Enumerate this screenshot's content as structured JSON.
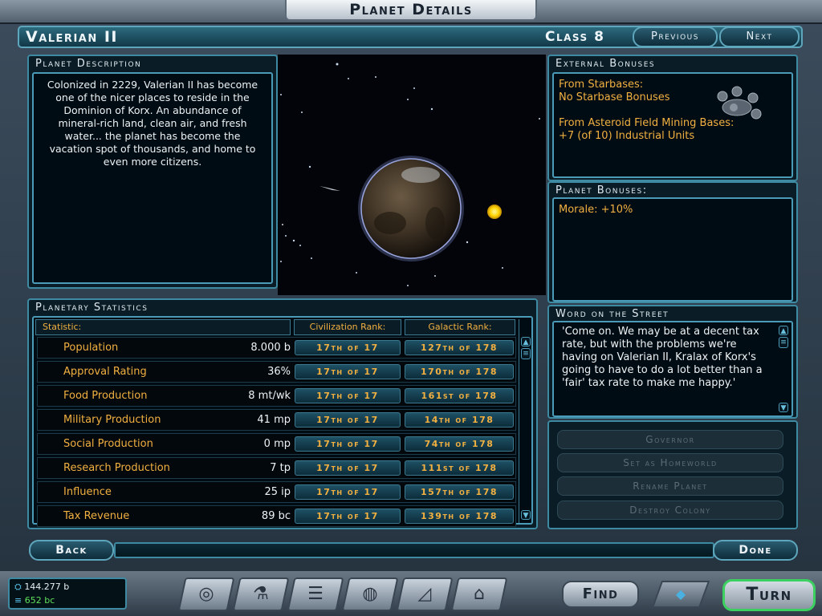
{
  "window": {
    "title": "Planet Details"
  },
  "header": {
    "planet_name": "Valerian II",
    "planet_class": "Class 8",
    "previous_label": "Previous",
    "next_label": "Next"
  },
  "description": {
    "title": "Planet Description",
    "text": "Colonized in 2229, Valerian II has become one of the nicer places to reside in the Dominion of Korx.  An abundance of mineral-rich land, clean air, and fresh water... the planet has become the vacation spot of thousands, and home to even more citizens."
  },
  "statistics": {
    "title": "Planetary Statistics",
    "columns": [
      "Statistic:",
      "Civilization Rank:",
      "Galactic Rank:"
    ],
    "rows": [
      {
        "name": "Population",
        "value": "8.000 b",
        "civ_rank": "17th of 17",
        "gal_rank": "127th of 178"
      },
      {
        "name": "Approval Rating",
        "value": "36%",
        "civ_rank": "17th of 17",
        "gal_rank": "170th of 178"
      },
      {
        "name": "Food Production",
        "value": "8 mt/wk",
        "civ_rank": "17th of 17",
        "gal_rank": "161st of 178"
      },
      {
        "name": "Military Production",
        "value": "41 mp",
        "civ_rank": "17th of 17",
        "gal_rank": "14th of 178"
      },
      {
        "name": "Social Production",
        "value": "0 mp",
        "civ_rank": "17th of 17",
        "gal_rank": "74th of 178"
      },
      {
        "name": "Research Production",
        "value": "7 tp",
        "civ_rank": "17th of 17",
        "gal_rank": "111st of 178"
      },
      {
        "name": "Influence",
        "value": "25 ip",
        "civ_rank": "17th of 17",
        "gal_rank": "157th of 178"
      },
      {
        "name": "Tax Revenue",
        "value": "89 bc",
        "civ_rank": "17th of 17",
        "gal_rank": "139th of 178"
      }
    ]
  },
  "external_bonuses": {
    "title": "External Bonuses",
    "starbase_label": "From Starbases:",
    "starbase_value": "No Starbase Bonuses",
    "mining_label": "From Asteroid Field Mining Bases:",
    "mining_value": "+7 (of 10) Industrial Units"
  },
  "planet_bonuses": {
    "title": "Planet Bonuses:",
    "text": "Morale: +10%"
  },
  "street": {
    "title": "Word on the Street",
    "text": "'Come on. We may be at a decent tax rate, but with the problems we're having on Valerian II, Kralax of Korx's going to have to do a lot better than a 'fair' tax rate to make me happy.'"
  },
  "actions": {
    "governor": "Governor",
    "set_homeworld": "Set as Homeworld",
    "rename": "Rename Planet",
    "destroy": "Destroy Colony"
  },
  "footer": {
    "back": "Back",
    "done": "Done"
  },
  "status": {
    "credits": "144.277 b",
    "income": "652 bc"
  },
  "taskbar": {
    "find": "Find",
    "turn": "Turn"
  },
  "colors": {
    "accent": "#3d8aa2",
    "label_orange": "#f2b040",
    "panel_bg": "#0a1c26"
  }
}
